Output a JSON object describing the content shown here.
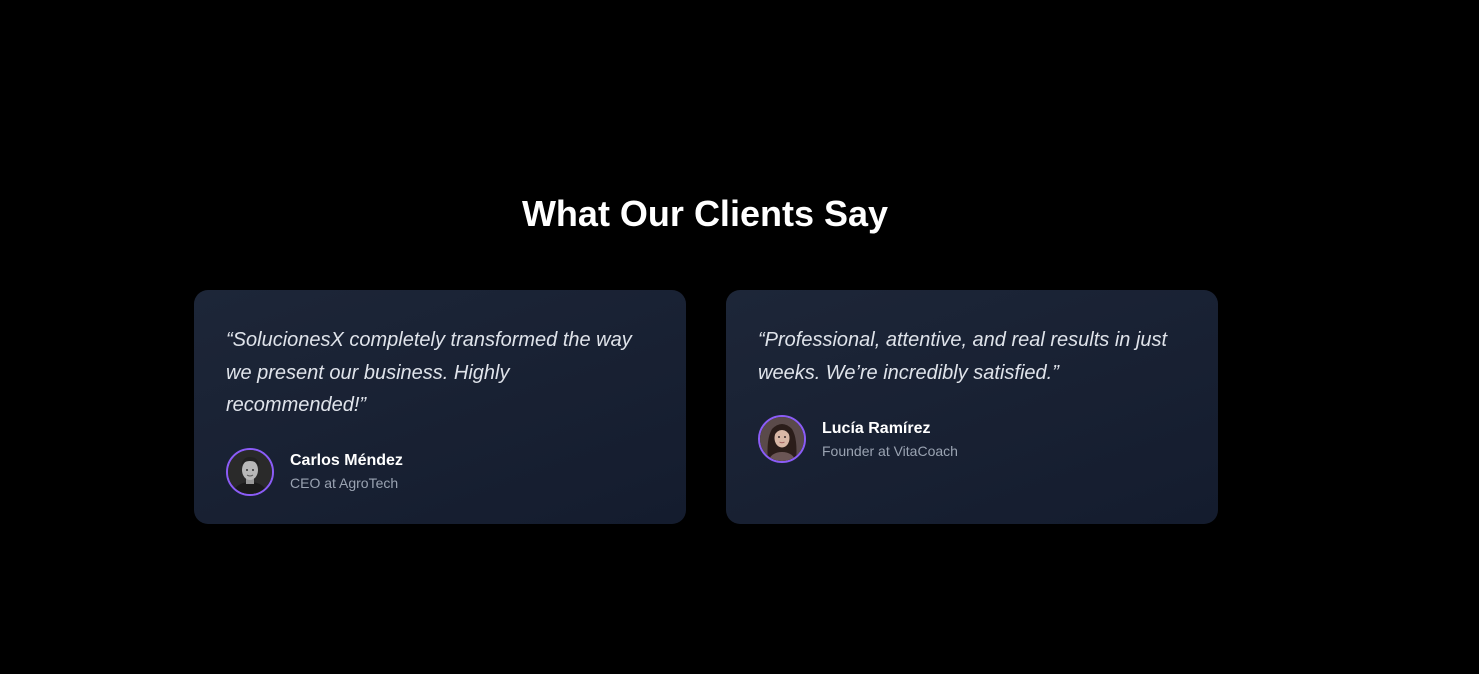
{
  "testimonials_section": {
    "title": "What Our Clients Say",
    "items": [
      {
        "quote": "“SolucionesX completely transformed the way we present our business. Highly recommended!”",
        "name": "Carlos Méndez",
        "role": "CEO at AgroTech",
        "avatar_icon": "man-portrait-avatar"
      },
      {
        "quote": "“Professional, attentive, and real results in just weeks. We’re incredibly satisfied.”",
        "name": "Lucía Ramírez",
        "role": "Founder at VitaCoach",
        "avatar_icon": "woman-portrait-avatar"
      }
    ]
  },
  "colors": {
    "page_background": "#000000",
    "card_background": "#1a2234",
    "avatar_ring": "#8b5cf6",
    "quote_text": "#dfe3ea",
    "role_text": "#9aa3b2"
  }
}
